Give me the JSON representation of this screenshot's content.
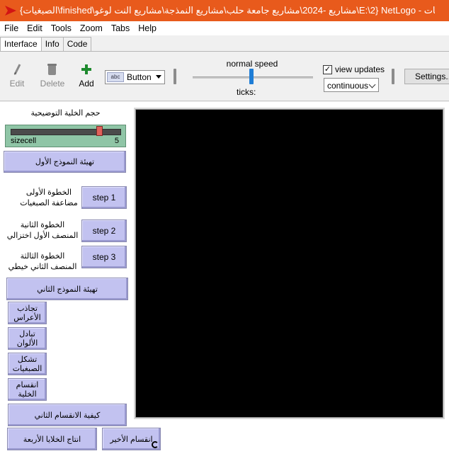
{
  "window": {
    "title": "{الصبغيات\\finished\\مشاريع -2024\\مشاريع جامعة حلب\\مشاريع النمذجة\\مشاريع النت لوغو\\E:\\2} NetLogo - الصبغيات"
  },
  "menu": [
    "File",
    "Edit",
    "Tools",
    "Zoom",
    "Tabs",
    "Help"
  ],
  "tabs": [
    "Interface",
    "Info",
    "Code"
  ],
  "toolbar": {
    "edit_label": "Edit",
    "delete_label": "Delete",
    "add_label": "Add",
    "widget_type": "Button",
    "widget_icon_text": "abc",
    "speed_label": "normal speed",
    "speed_level": 0.5,
    "ticks_label": "ticks:",
    "view_updates_label": "view updates",
    "view_updates_checked": true,
    "update_mode": "continuous",
    "settings_label": "Settings..."
  },
  "interface": {
    "slider_title": "حجم الخلية التوضيحية",
    "slider": {
      "name": "sizecell",
      "value": "5"
    },
    "buttons": {
      "setup1": "تهيئة النموذج الأول",
      "step1": "step 1",
      "step2": "step 2",
      "step3": "step 3",
      "setup2": "تهيئة النموذج الثاني",
      "attract": "تجاذب الأعراس",
      "swap_colors": "تبادل الألوان",
      "form_chrom": "تشكل الصبغيات",
      "cell_division": "انقسام الخلية",
      "second_division": "كيفية الانقسام الثاني",
      "four_cells": "انتاج الخلايا الأربعة",
      "last_division": "انقسام الأخير"
    },
    "notes": {
      "step1_l1": "الخطوة الأولى",
      "step1_l2": "مضاعفة الصبغيات",
      "step2_l1": "الخطوة الثانية",
      "step2_l2": "المنصف الأول اختزالي",
      "step3_l1": "الخطوة الثالثة",
      "step3_l2": "المنصف الثاني خيطي"
    }
  },
  "colors": {
    "titlebar": "#e85a1c",
    "button": "#c2c2f0",
    "slider": "#8fc5a6",
    "view": "#000000"
  }
}
